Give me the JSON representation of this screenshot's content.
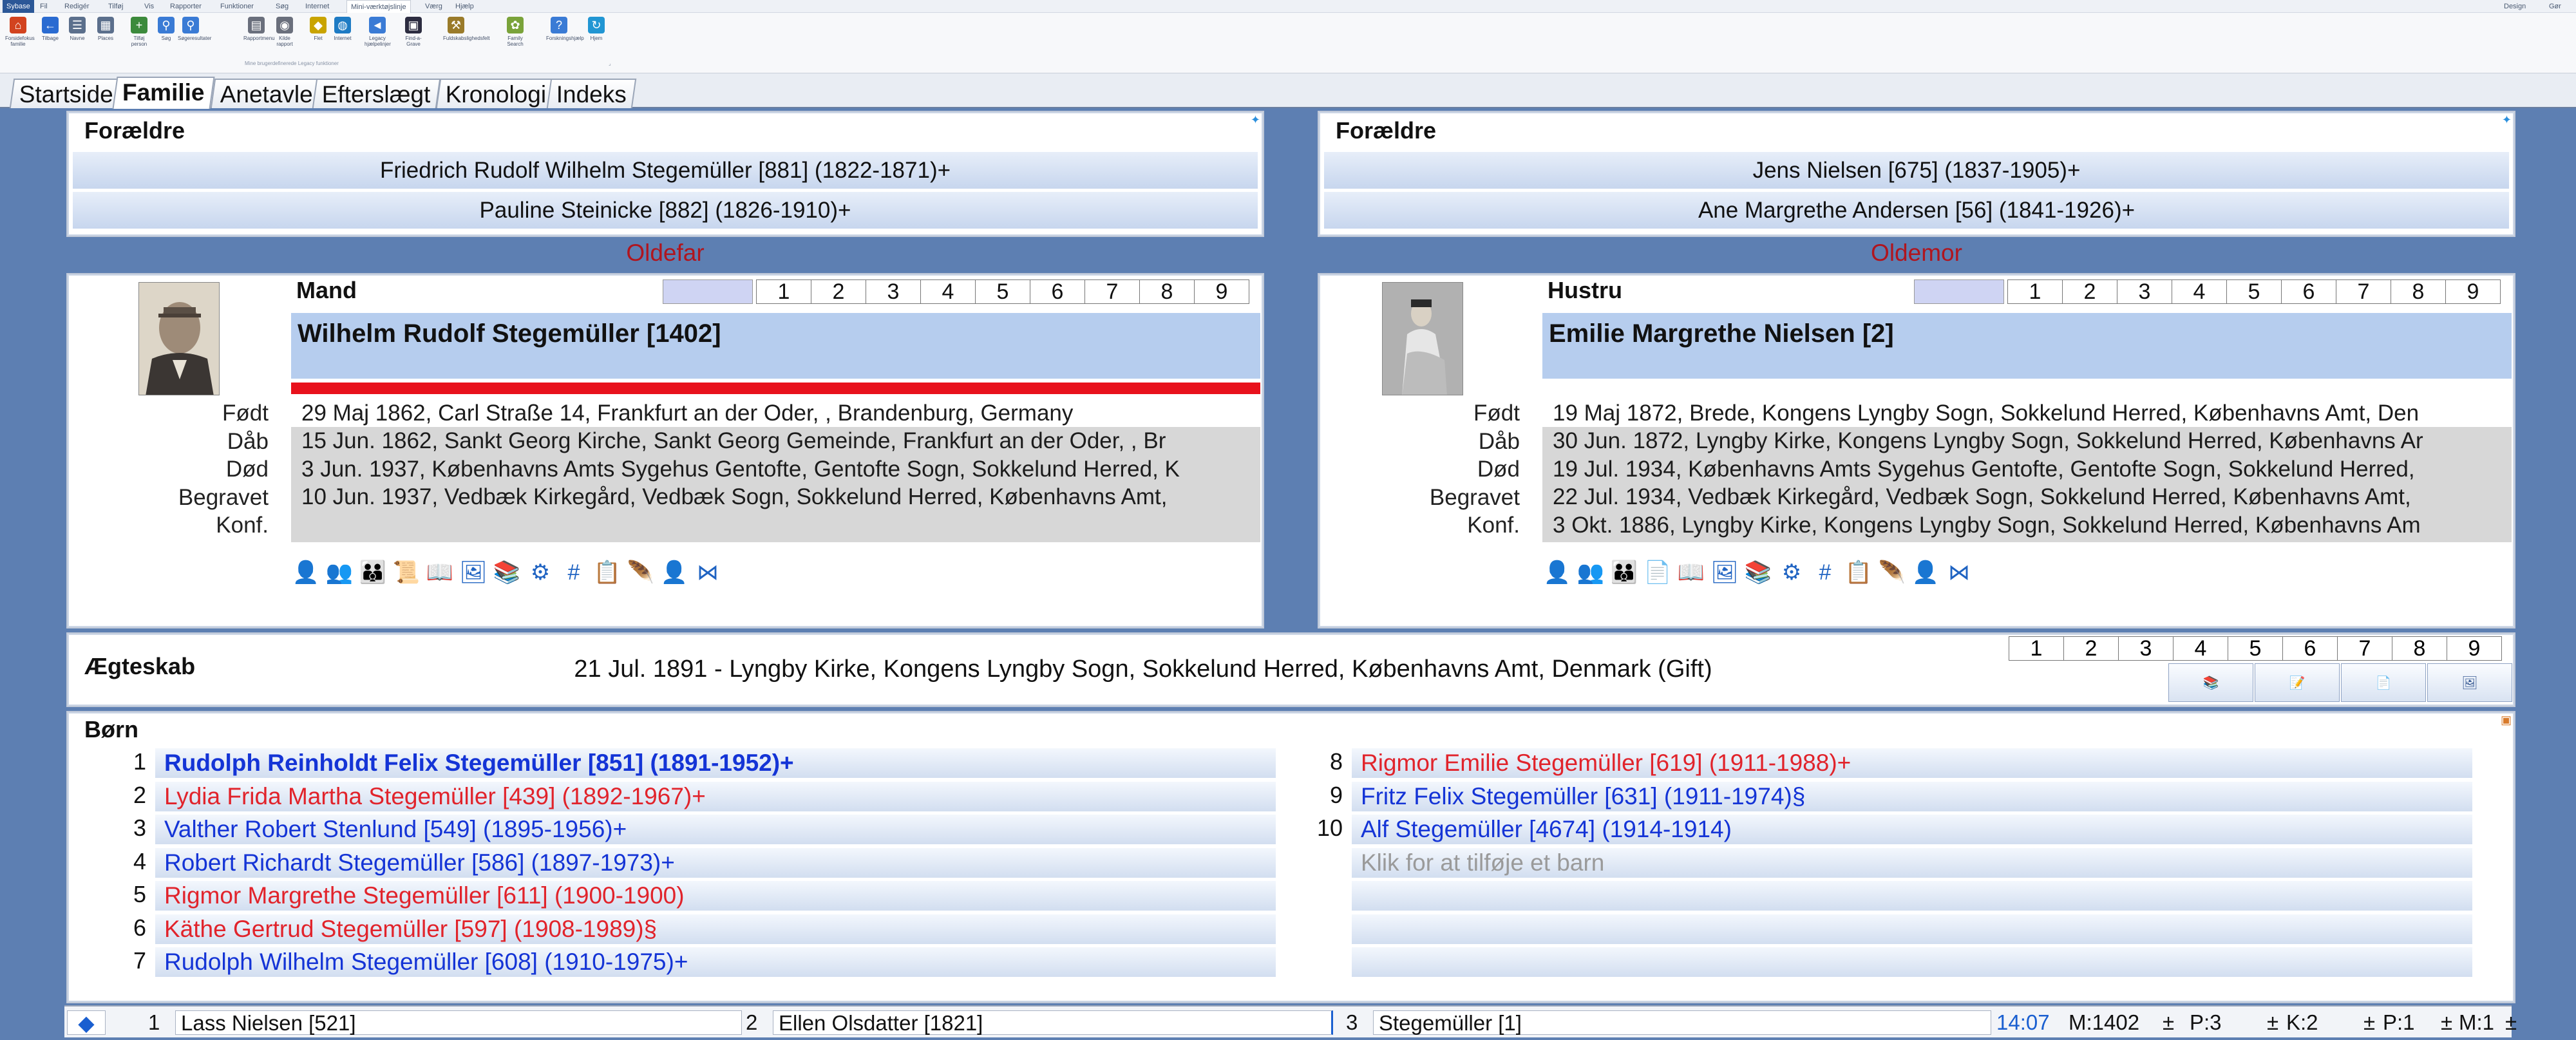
{
  "menu": {
    "items": [
      "Sybase",
      "Fil",
      "Redigér",
      "Tilføj",
      "Vis",
      "Rapporter",
      "Funktioner",
      "Søg",
      "Internet",
      "Mini-værktøjslinje",
      "Værg",
      "Hjælp"
    ],
    "right_items": [
      "Design",
      "Gør"
    ]
  },
  "ribbon": {
    "buttons": [
      {
        "label": "Forsidefokus familie",
        "icon": "home-icon",
        "color": "#d2431f"
      },
      {
        "label": "Tilbage",
        "icon": "back-arrow-icon",
        "color": "#2a6bd1"
      },
      {
        "label": "Navne",
        "icon": "name-list-icon",
        "color": "#5b6f8c"
      },
      {
        "label": "Places",
        "icon": "places-icon",
        "color": "#5b6f8c"
      },
      {
        "label": "Tilføj person",
        "icon": "add-person-icon",
        "color": "#3c8a3c"
      },
      {
        "label": "Søg",
        "icon": "search-icon",
        "color": "#3a7bd5"
      },
      {
        "label": "Søgeresultater",
        "icon": "search-results-icon",
        "color": "#3a7bd5"
      },
      {
        "label": "Rapportmenu",
        "icon": "report-icon",
        "color": "#6a6f7c"
      },
      {
        "label": "Kilde rapport",
        "icon": "source-report-icon",
        "color": "#6a6f7c"
      },
      {
        "label": "Flet",
        "icon": "merge-icon",
        "color": "#c9a400"
      },
      {
        "label": "Internet",
        "icon": "globe-icon",
        "color": "#1e7bc4"
      },
      {
        "label": "Legacy hjælpelinjer",
        "icon": "legacy-help-icon",
        "color": "#3a7bd5"
      },
      {
        "label": "Find-a-Grave",
        "icon": "grave-icon",
        "color": "#2c2c40"
      },
      {
        "label": "Fuldskabslighedsfelt",
        "icon": "tools-icon",
        "color": "#9a7b2a"
      },
      {
        "label": "Family Search",
        "icon": "familysearch-icon",
        "color": "#7aa33a"
      },
      {
        "label": "Forskningshjælp",
        "icon": "research-icon",
        "color": "#3a7bd5"
      },
      {
        "label": "Hjem",
        "icon": "refresh-icon",
        "color": "#2196d3"
      }
    ],
    "group_label": "Mine brugerdefinerede Legacy funktioner"
  },
  "tabs": [
    "Startside",
    "Familie",
    "Anetavle",
    "Efterslægt",
    "Kronologi",
    "Indeks"
  ],
  "selected_tab": "Familie",
  "left": {
    "parents_title": "Forældre",
    "parents": [
      "Friedrich Rudolf Wilhelm Stegemüller [881] (1822-1871)+",
      "Pauline Steinicke [882] (1826-1910)+"
    ],
    "generation": "Oldefar",
    "role": "Mand",
    "name": "Wilhelm Rudolf Stegemüller [1402]",
    "event_labels": [
      "Født",
      "Dåb",
      "Død",
      "Begravet",
      "Konf."
    ],
    "events": [
      "29 Maj 1862, Carl Straße 14, Frankfurt an der Oder, , Brandenburg, Germany",
      "15 Jun. 1862, Sankt Georg Kirche, Sankt Georg Gemeinde, Frankfurt an der Oder, , Br",
      "3 Jun. 1937, Københavns Amts Sygehus Gentofte, Gentofte Sogn, Sokkelund Herred, K",
      "10 Jun. 1937, Vedbæk Kirkegård, Vedbæk Sogn, Sokkelund Herred, Københavns Amt,",
      ""
    ]
  },
  "right": {
    "parents_title": "Forældre",
    "parents": [
      "Jens Nielsen [675] (1837-1905)+",
      "Ane Margrethe Andersen [56] (1841-1926)+"
    ],
    "generation": "Oldemor",
    "role": "Hustru",
    "name": "Emilie Margrethe Nielsen [2]",
    "event_labels": [
      "Født",
      "Dåb",
      "Død",
      "Begravet",
      "Konf."
    ],
    "events": [
      "19 Maj 1872, Brede, Kongens Lyngby Sogn, Sokkelund Herred, Københavns Amt, Den",
      "30 Jun. 1872, Lyngby Kirke, Kongens Lyngby Sogn, Sokkelund Herred, Københavns Ar",
      "19 Jul. 1934, Københavns Amts Sygehus Gentofte, Gentofte Sogn, Sokkelund Herred,",
      "22 Jul. 1934, Vedbæk Kirkegård, Vedbæk Sogn, Sokkelund Herred, Københavns Amt,",
      "3 Okt. 1886, Lyngby Kirke, Kongens Lyngby Sogn, Sokkelund Herred, Københavns Am"
    ]
  },
  "numbers": [
    "1",
    "2",
    "3",
    "4",
    "5",
    "6",
    "7",
    "8",
    "9"
  ],
  "marriage": {
    "title": "Ægteskab",
    "text": "21 Jul. 1891 - Lyngby Kirke, Kongens Lyngby Sogn, Sokkelund Herred, Københavns Amt, Denmark (Gift)"
  },
  "children": {
    "title": "Børn",
    "left": [
      {
        "no": "1",
        "text": "Rudolph Reinholdt Felix Stegemüller [851] (1891-1952)+",
        "sex": "m",
        "bold": true
      },
      {
        "no": "2",
        "text": "Lydia Frida Martha Stegemüller [439] (1892-1967)+",
        "sex": "f"
      },
      {
        "no": "3",
        "text": "Valther Robert Stenlund [549] (1895-1956)+",
        "sex": "m"
      },
      {
        "no": "4",
        "text": "Robert Richardt Stegemüller [586] (1897-1973)+",
        "sex": "m"
      },
      {
        "no": "5",
        "text": "Rigmor Margrethe Stegemüller [611] (1900-1900)",
        "sex": "f"
      },
      {
        "no": "6",
        "text": "Käthe Gertrud Stegemüller [597] (1908-1989)§",
        "sex": "f"
      },
      {
        "no": "7",
        "text": "Rudolph Wilhelm Stegemüller [608] (1910-1975)+",
        "sex": "m"
      }
    ],
    "right": [
      {
        "no": "8",
        "text": "Rigmor Emilie Stegemüller [619] (1911-1988)+",
        "sex": "f"
      },
      {
        "no": "9",
        "text": "Fritz Felix Stegemüller [631] (1911-1974)§",
        "sex": "m"
      },
      {
        "no": "10",
        "text": "Alf Stegemüller [4674] (1914-1914)",
        "sex": "m"
      },
      {
        "no": "",
        "text": "Klik for at tilføje et barn",
        "sex": "add"
      },
      {
        "no": "",
        "text": "",
        "sex": "add"
      },
      {
        "no": "",
        "text": "",
        "sex": "add"
      },
      {
        "no": "",
        "text": "",
        "sex": "add"
      }
    ]
  },
  "status": {
    "slot1_no": "1",
    "slot1": "Lass Nielsen [521]",
    "slot2_no": "2",
    "slot2": "Ellen Olsdatter [1821]",
    "slot3_no": "3",
    "slot3": "Stegemüller [1]",
    "time": "14:07",
    "m": "M:1402",
    "p": "P:3",
    "k": "K:2",
    "p2": "P:1",
    "m2": "M:1"
  }
}
